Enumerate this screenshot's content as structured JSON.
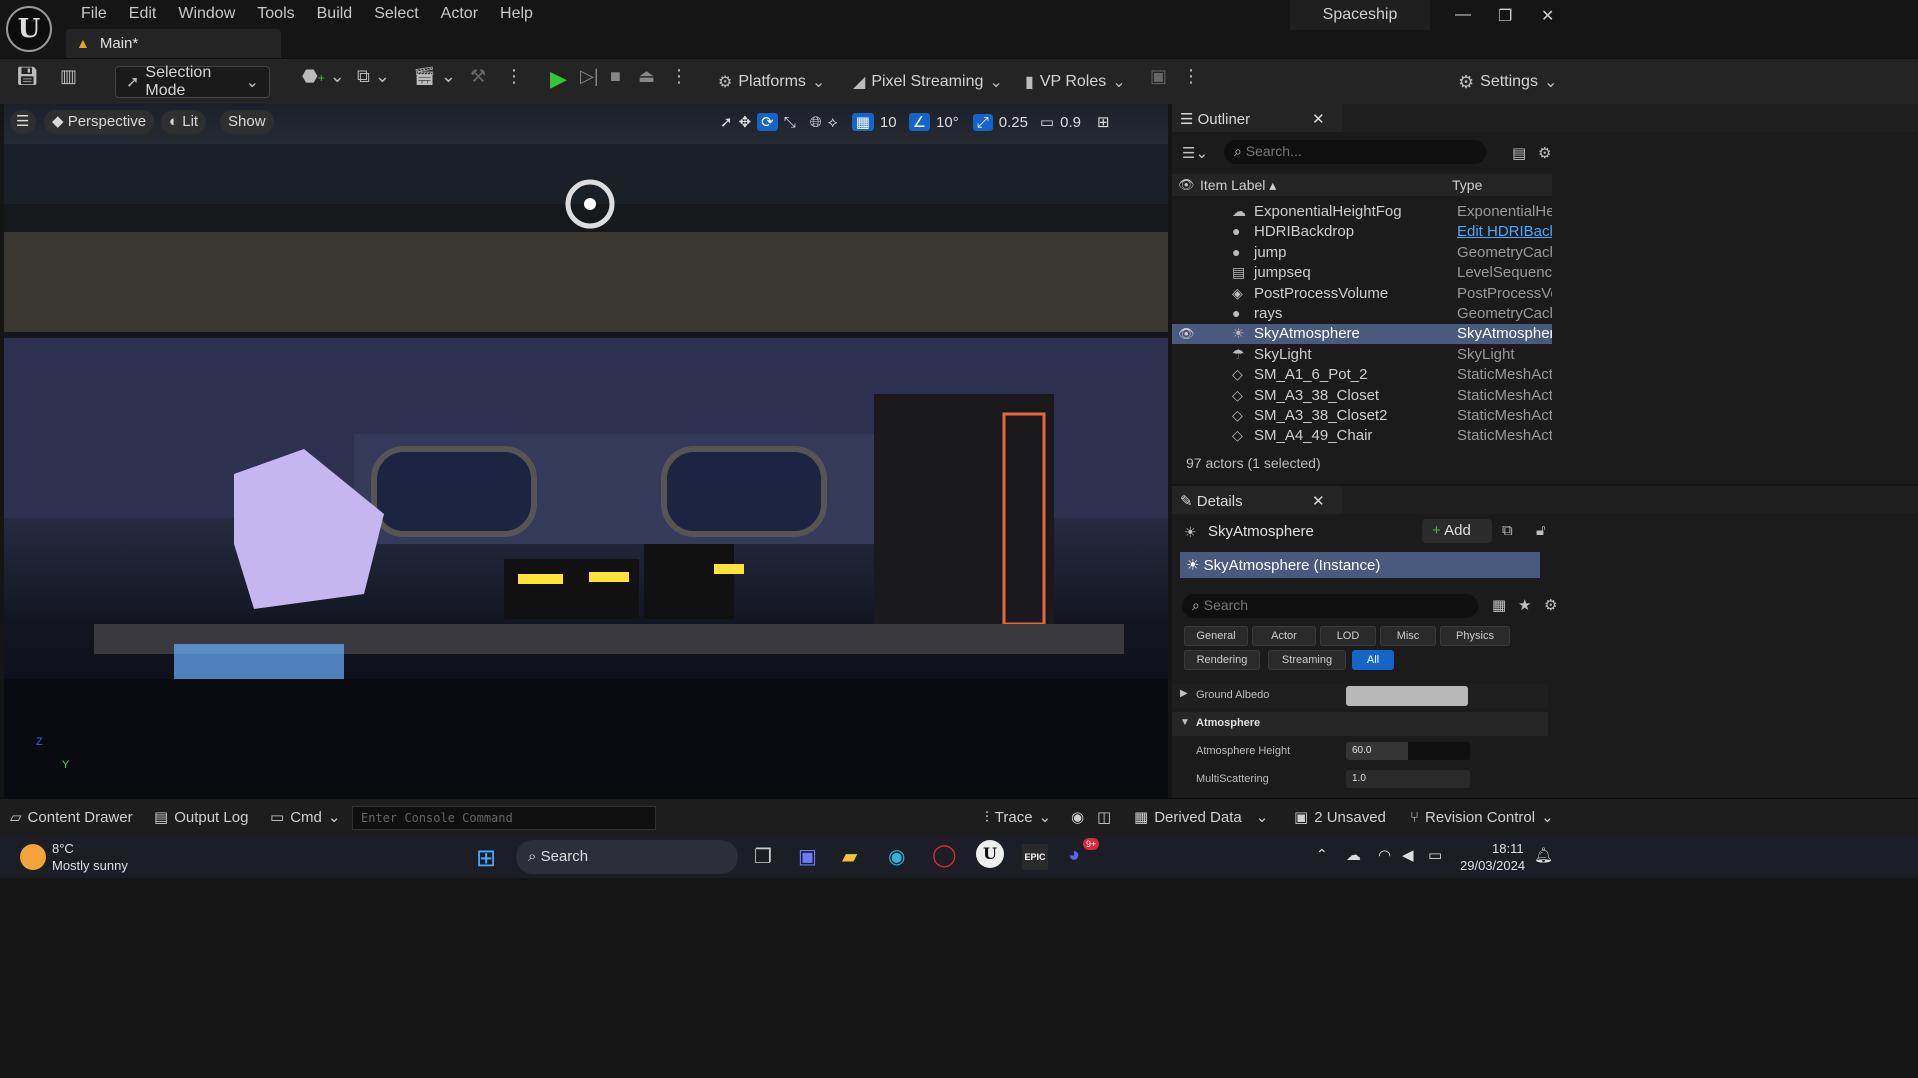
{
  "titlebar": {
    "logo": "U",
    "menu": [
      "File",
      "Edit",
      "Window",
      "Tools",
      "Build",
      "Select",
      "Actor",
      "Help"
    ],
    "doc_tab": "Main*",
    "project": "Spaceship",
    "win_min": "—",
    "win_max": "❐",
    "win_close": "✕"
  },
  "toolbar": {
    "mode": "Selection Mode",
    "platforms": "Platforms",
    "pixel_streaming": "Pixel Streaming",
    "vp_roles": "VP Roles",
    "settings": "Settings"
  },
  "viewport": {
    "perspective": "Perspective",
    "lit": "Lit",
    "show": "Show",
    "grid_snap": "10",
    "rot_snap": "10°",
    "scale_snap": "0.25",
    "cam_speed": "0.9",
    "axis_z": "Z",
    "axis_y": "Y"
  },
  "outliner": {
    "title": "Outliner",
    "search_placeholder": "Search...",
    "col_label": "Item Label ▴",
    "col_type": "Type",
    "rows": [
      {
        "name": "ExponentialHeightFog",
        "type": "ExponentialHei",
        "icon": "fog-icon",
        "glyph": "☁"
      },
      {
        "name": "HDRIBackdrop",
        "type": "Edit HDRIBack",
        "icon": "sphere-icon",
        "glyph": "●"
      },
      {
        "name": "jump",
        "type": "GeometryCach",
        "icon": "actor-icon",
        "glyph": "●"
      },
      {
        "name": "jumpseq",
        "type": "LevelSequence",
        "icon": "sequence-icon",
        "glyph": "▤"
      },
      {
        "name": "PostProcessVolume",
        "type": "PostProcessVo",
        "icon": "volume-icon",
        "glyph": "◈"
      },
      {
        "name": "rays",
        "type": "GeometryCach",
        "icon": "actor-icon",
        "glyph": "●"
      },
      {
        "name": "SkyAtmosphere",
        "type": "SkyAtmospher",
        "icon": "sky-icon",
        "glyph": "☀"
      },
      {
        "name": "SkyLight",
        "type": "SkyLight",
        "icon": "skylight-icon",
        "glyph": "☂"
      },
      {
        "name": "SM_A1_6_Pot_2",
        "type": "StaticMeshAct",
        "icon": "mesh-icon",
        "glyph": "◇"
      },
      {
        "name": "SM_A3_38_Closet",
        "type": "StaticMeshAct",
        "icon": "mesh-icon",
        "glyph": "◇"
      },
      {
        "name": "SM_A3_38_Closet2",
        "type": "StaticMeshAct",
        "icon": "mesh-icon",
        "glyph": "◇"
      },
      {
        "name": "SM_A4_49_Chair",
        "type": "StaticMeshAct",
        "icon": "mesh-icon",
        "glyph": "◇"
      }
    ],
    "status": "97 actors (1 selected)"
  },
  "details": {
    "title": "Details",
    "actor": "SkyAtmosphere",
    "add": "Add",
    "instance": "SkyAtmosphere (Instance)",
    "search_placeholder": "Search",
    "categories": [
      "General",
      "Actor",
      "LOD",
      "Misc",
      "Physics",
      "Rendering",
      "Streaming",
      "All"
    ],
    "ground_albedo": "Ground Albedo",
    "section": "Atmosphere",
    "atm_height_label": "Atmosphere Height",
    "atm_height_value": "60.0",
    "atm_height_level": 0.5,
    "multiscatter_label": "MultiScattering",
    "multiscatter_value": "1.0"
  },
  "bottombar": {
    "content_drawer": "Content Drawer",
    "output_log": "Output Log",
    "cmd": "Cmd",
    "console_placeholder": "Enter Console Command",
    "trace": "Trace",
    "derived_data": "Derived Data",
    "unsaved": "2 Unsaved",
    "revision": "Revision Control"
  },
  "taskbar": {
    "temp": "8°C",
    "weather": "Mostly sunny",
    "search": "Search",
    "time": "18:11",
    "date": "29/03/2024",
    "badge": "9+",
    "epic": "EPIC"
  }
}
